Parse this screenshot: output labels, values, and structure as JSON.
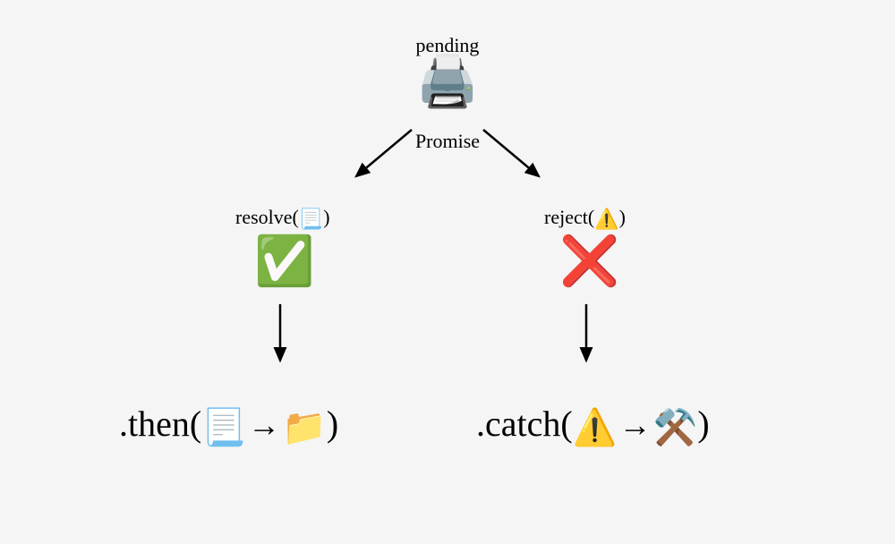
{
  "top": {
    "pending_label": "pending",
    "promise_label": "Promise",
    "printer_emoji": "🖨️"
  },
  "left": {
    "resolve_prefix": "resolve(",
    "resolve_emoji": "📃",
    "resolve_suffix": ")",
    "check_emoji": "✅",
    "then_prefix": ".then(",
    "then_source_emoji": "📃",
    "then_target_emoji": "📁",
    "then_suffix": ")"
  },
  "right": {
    "reject_prefix": "reject(",
    "reject_emoji": "⚠️",
    "reject_suffix": ")",
    "cross_emoji": "❌",
    "catch_prefix": ".catch(",
    "catch_source_emoji": "⚠️",
    "catch_target_emoji": "⚒️",
    "catch_suffix": ")"
  }
}
